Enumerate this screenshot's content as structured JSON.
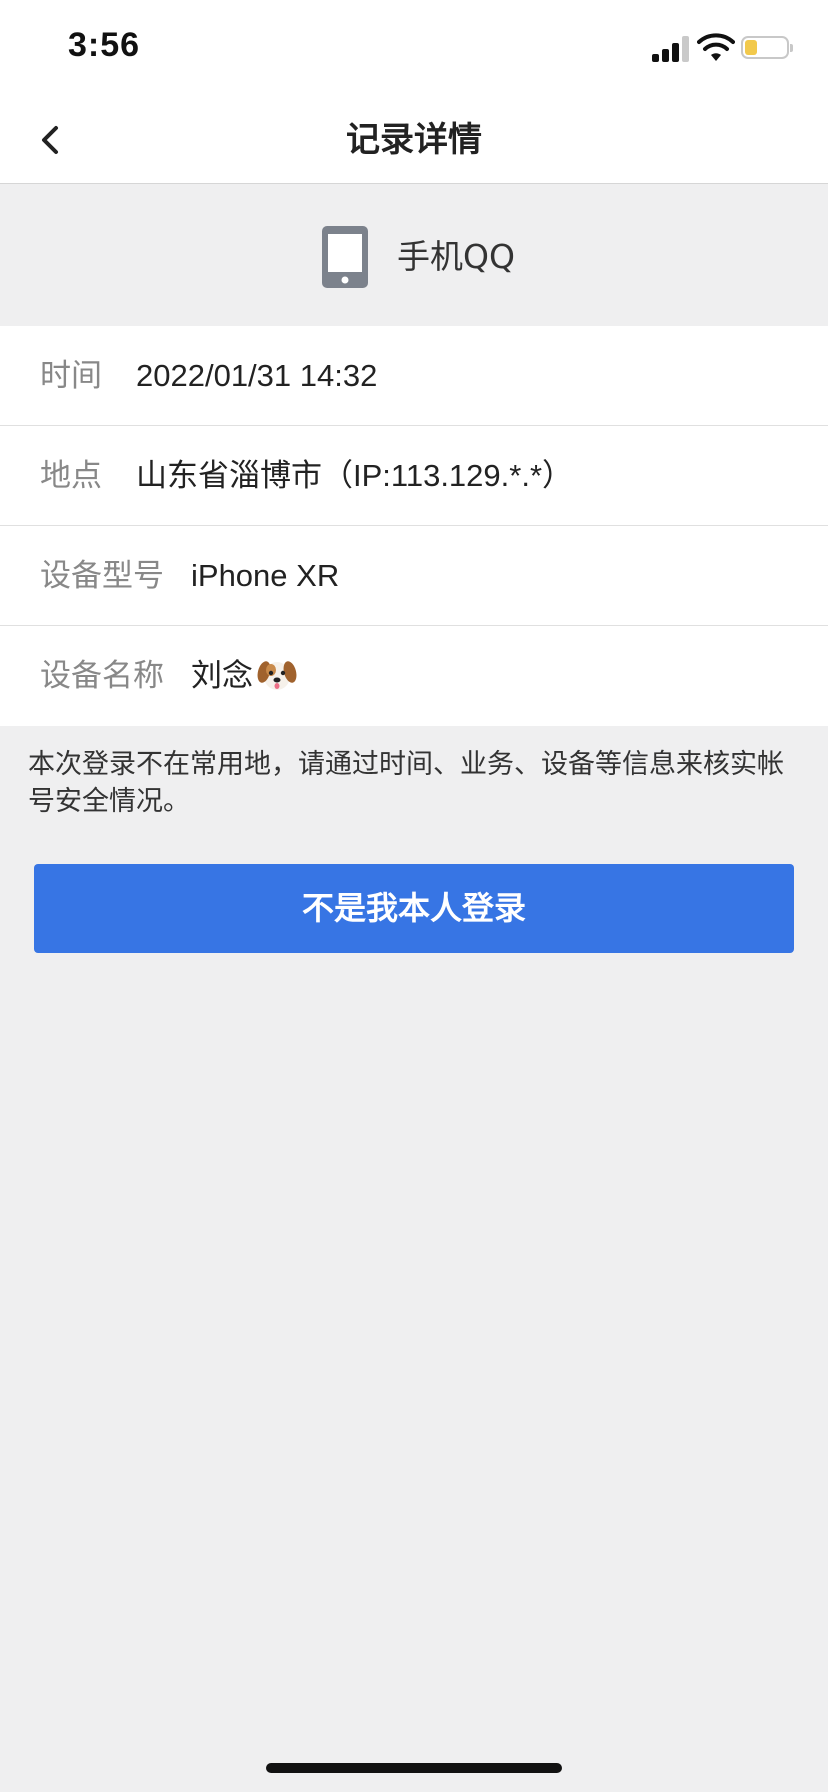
{
  "status_bar": {
    "time": "3:56",
    "icons": [
      "signal-icon",
      "wifi-icon",
      "battery-icon"
    ],
    "battery_color": "#f2c94c"
  },
  "nav": {
    "back_icon": "chevron-left-icon",
    "title": "记录详情"
  },
  "app": {
    "icon": "phone-device-icon",
    "name": "手机QQ"
  },
  "details": [
    {
      "label": "时间",
      "value": "2022/01/31 14:32"
    },
    {
      "label": "地点",
      "value": "山东省淄博市（IP:113.129.*.*）"
    },
    {
      "label": "设备型号",
      "value": "iPhone XR"
    },
    {
      "label": "设备名称",
      "value": "刘念",
      "emoji": "dog-face-icon"
    }
  ],
  "notice": "本次登录不在常用地，请通过时间、业务、设备等信息来核实帐号安全情况。",
  "actions": {
    "not_me_label": "不是我本人登录"
  },
  "colors": {
    "accent": "#3775e4",
    "background": "#efeff0"
  }
}
